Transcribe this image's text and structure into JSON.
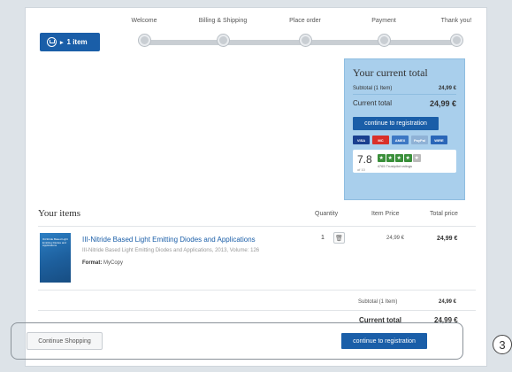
{
  "cart": {
    "count_label": "1 item"
  },
  "steps": [
    "Welcome",
    "Billing & Shipping",
    "Place order",
    "Payment",
    "Thank you!"
  ],
  "summary": {
    "title": "Your current total",
    "subtotal_label": "Subtotal (1 Item)",
    "subtotal_value": "24,99 €",
    "total_label": "Current total",
    "total_value": "24,99 €",
    "cta_label": "continue to registration",
    "payments": [
      {
        "label": "VISA",
        "color": "#1a3f8f"
      },
      {
        "label": "MC",
        "color": "#d9302a"
      },
      {
        "label": "AMEX",
        "color": "#3d78c4"
      },
      {
        "label": "PayPal",
        "color": "#8fb2d6"
      },
      {
        "label": "WIRE",
        "color": "#2a66b8"
      }
    ],
    "trustpilot": {
      "score": "7.8",
      "of": "of 10",
      "ratings": "4765 Trustpilot ratings"
    }
  },
  "items_section": {
    "title": "Your items",
    "headers": {
      "quantity": "Quantity",
      "item_price": "Item Price",
      "total_price": "Total price"
    },
    "item": {
      "cover_text": "III-Nitride Based Light Emitting Diodes and Applications",
      "title": "III-Nitride Based Light Emitting Diodes and Applications",
      "subtitle": "III-Nitride Based Light Emitting Diodes and Applications, 2013, Volume: 126",
      "format_label": "Format:",
      "format_value": "MyCopy",
      "quantity": "1",
      "item_price": "24,99 €",
      "total_price": "24,99 €"
    },
    "footer": {
      "subtotal_label": "Subtotal (1 Item)",
      "subtotal_value": "24,99 €",
      "total_label": "Current total",
      "total_value": "24,99 €"
    }
  },
  "bottom": {
    "continue_shopping": "Continue Shopping",
    "continue_registration": "continue to registration"
  },
  "annotation_badge": "3"
}
